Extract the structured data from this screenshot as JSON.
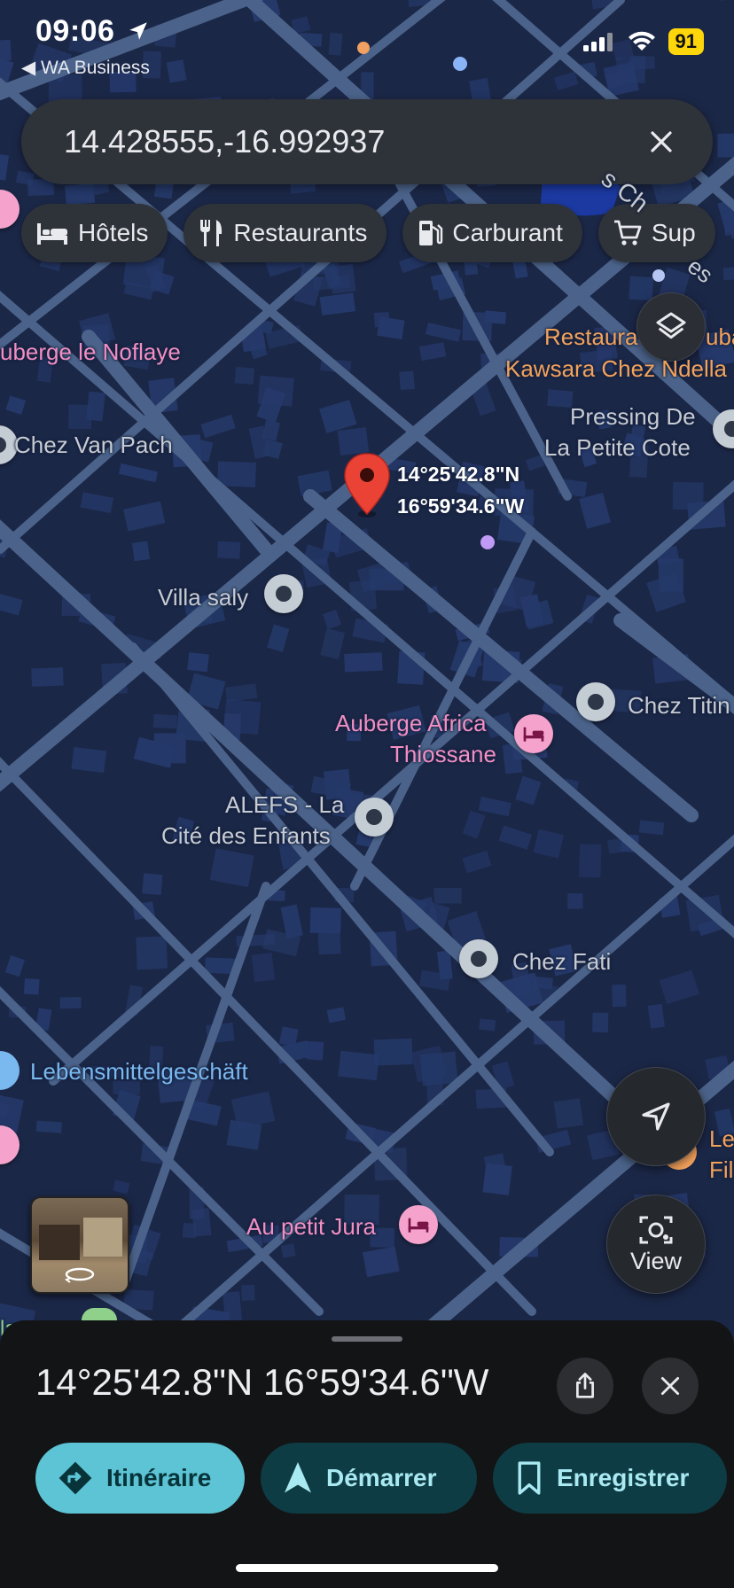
{
  "status_bar": {
    "time": "09:06",
    "back_app": "◀ WA Business",
    "battery": "91",
    "icons": [
      "location-arrow-icon",
      "signal-icon",
      "wifi-icon",
      "battery-icon"
    ]
  },
  "search": {
    "value": "14.428555,-16.992937",
    "clear_icon": "close-icon"
  },
  "chips": [
    {
      "label": "Hôtels",
      "icon": "bed-icon"
    },
    {
      "label": "Restaurants",
      "icon": "fork-knife-icon"
    },
    {
      "label": "Carburant",
      "icon": "fuel-icon"
    },
    {
      "label": "Sup",
      "icon": "cart-icon"
    }
  ],
  "map": {
    "pin_coords": {
      "lat": "14°25'42.8\"N",
      "lng": "16°59'34.6\"W"
    },
    "labels": {
      "noflaye": "uberge le Noflaye",
      "van_pach": "Chez Van Pach",
      "restau_1": "Restaura",
      "restau_2": "uba",
      "kawsara": "Kawsara Chez Ndella",
      "pressing_1": "Pressing De",
      "pressing_2": "La Petite Cote",
      "villa_saly": "Villa saly",
      "chez_titi": "Chez Titin",
      "auberge_africa_1": "Auberge Africa",
      "auberge_africa_2": "Thiossane",
      "alefs_1": "ALEFS - La",
      "alefs_2": "Cité des Enfants",
      "chez_fati": "Chez Fati",
      "lebensmittel": "Lebensmittelgeschäft",
      "au_petit_jura": "Au petit Jura",
      "le_1": "Le",
      "le_2": "Fil",
      "street_fragment": "s Ch",
      "street_fragment_2": "es",
      "partial_bottom": "la"
    },
    "view_button": "View"
  },
  "sheet": {
    "title": "14°25'42.8\"N 16°59'34.6\"W",
    "actions": {
      "itineraire": "Itinéraire",
      "demarrer": "Démarrer",
      "enregistrer": "Enregistrer"
    }
  },
  "colors": {
    "map_bg": "#1b2747",
    "road": "#4a6289",
    "building": "#253a69",
    "accent_teal": "#5cc4d4",
    "pin_red": "#ea4335"
  }
}
